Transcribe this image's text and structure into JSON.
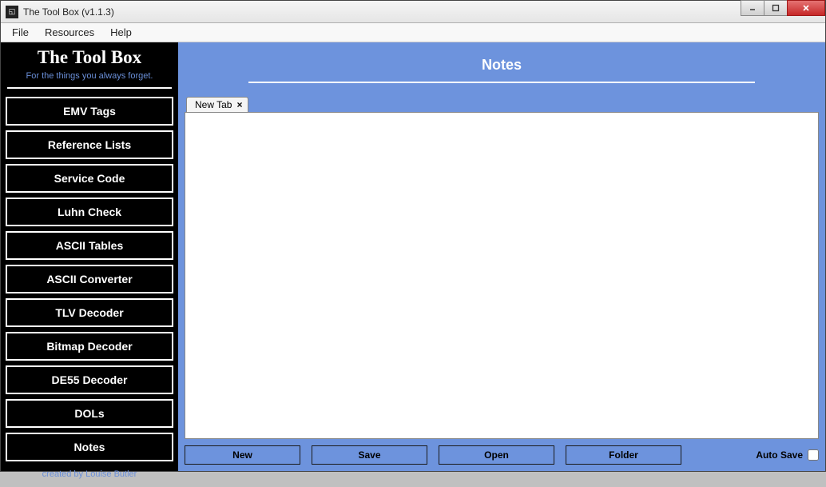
{
  "window": {
    "title": "The Tool Box (v1.1.3)"
  },
  "menubar": {
    "file": "File",
    "resources": "Resources",
    "help": "Help"
  },
  "sidebar": {
    "title": "The Tool Box",
    "subtitle": "For the things you always forget.",
    "items": [
      "EMV Tags",
      "Reference Lists",
      "Service Code",
      "Luhn Check",
      "ASCII Tables",
      "ASCII Converter",
      "TLV Decoder",
      "Bitmap Decoder",
      "DE55 Decoder",
      "DOLs",
      "Notes"
    ],
    "footer": "created by Louise Butler"
  },
  "main": {
    "header": "Notes",
    "tab_label": "New Tab",
    "tab_close": "×",
    "editor_value": "",
    "buttons": {
      "new": "New",
      "save": "Save",
      "open": "Open",
      "folder": "Folder"
    },
    "autosave_label": "Auto Save"
  }
}
